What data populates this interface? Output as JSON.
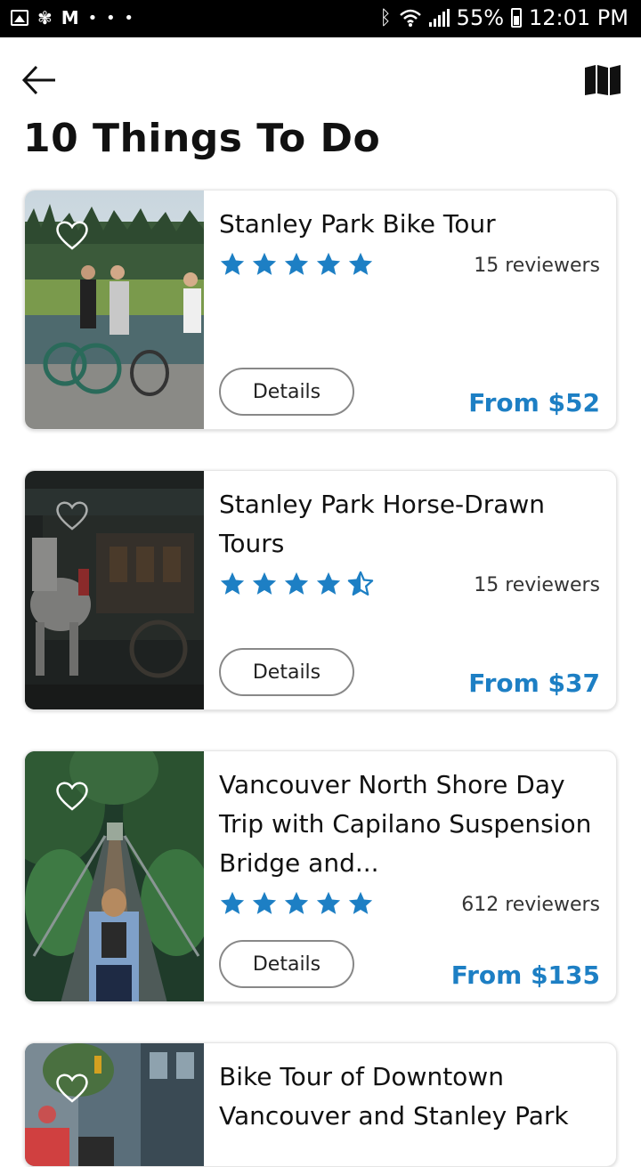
{
  "status_bar": {
    "battery": "55%",
    "time": "12:01 PM",
    "dots": "• • •"
  },
  "header": {
    "title": "10 Things To Do",
    "back_icon": "arrow-left-icon",
    "map_icon": "map-icon"
  },
  "colors": {
    "accent": "#1d7fc4",
    "star": "#1d7fc4"
  },
  "cards": [
    {
      "title": "Stanley Park Bike Tour",
      "rating": 5,
      "reviews": "15 reviewers",
      "details_label": "Details",
      "price": "From $52"
    },
    {
      "title": "Stanley Park Horse-Drawn Tours",
      "rating": 4.5,
      "reviews": "15 reviewers",
      "details_label": "Details",
      "price": "From $37"
    },
    {
      "title": "Vancouver North Shore Day Trip with Capilano Suspension Bridge and...",
      "rating": 5,
      "reviews": "612 reviewers",
      "details_label": "Details",
      "price": "From $135"
    },
    {
      "title": "Bike Tour of Downtown Vancouver and Stanley Park"
    }
  ]
}
